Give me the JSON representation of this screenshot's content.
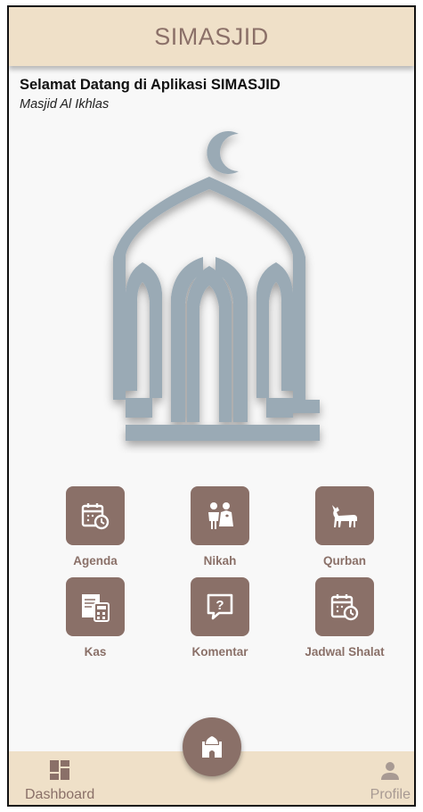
{
  "app": {
    "title": "SIMASJID"
  },
  "welcome": {
    "heading": "Selamat Datang di Aplikasi SIMASJID",
    "mosque_name": "Masjid Al Ikhlas"
  },
  "menu": {
    "items": [
      {
        "label": "Agenda",
        "icon": "calendar-clock-icon"
      },
      {
        "label": "Nikah",
        "icon": "wedding-couple-icon"
      },
      {
        "label": "Qurban",
        "icon": "goat-icon"
      },
      {
        "label": "Kas",
        "icon": "cash-calculator-icon"
      },
      {
        "label": "Komentar",
        "icon": "comment-question-icon"
      },
      {
        "label": "Jadwal Shalat",
        "icon": "calendar-clock-icon"
      }
    ]
  },
  "bottom_nav": {
    "dashboard_label": "Dashboard",
    "profile_label": "Profile",
    "center_icon": "mosque-icon"
  },
  "colors": {
    "header_bg": "#efe0c8",
    "accent": "#8a7068",
    "logo": "#9aaab5",
    "background": "#f8f8f8"
  }
}
